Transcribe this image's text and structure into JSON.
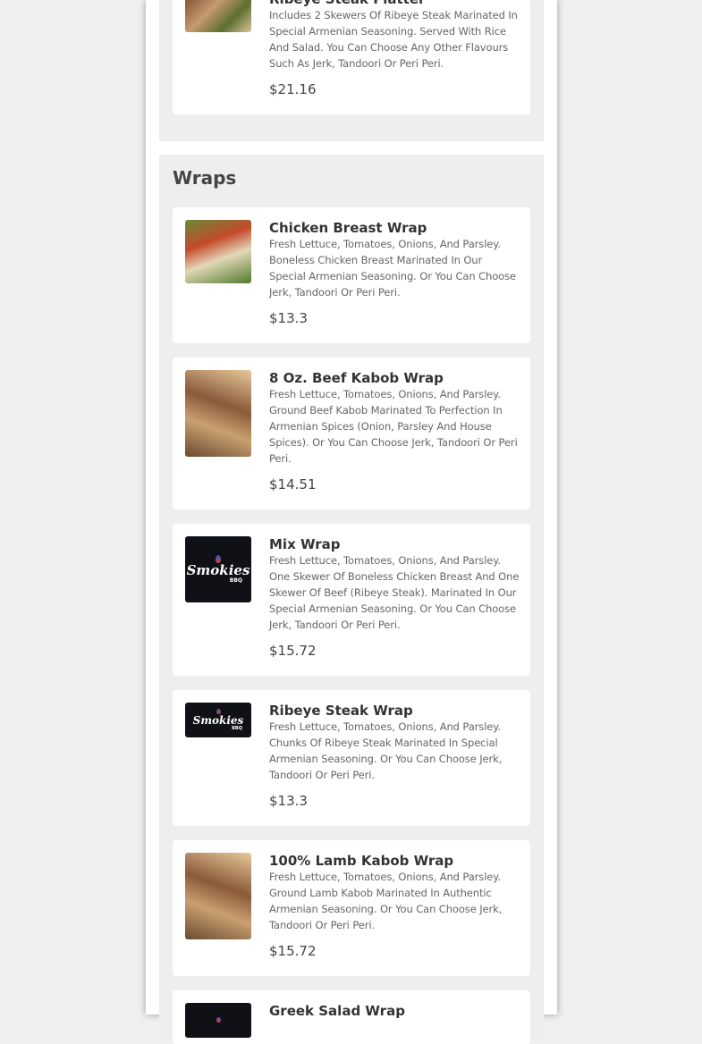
{
  "prev_section": {
    "item": {
      "name": "Ribeye Steak Platter",
      "description": "Includes 2 Skewers Of Ribeye Steak Marinated In Special Armenian Seasoning. Served With Rice And Salad. You Can Choose Any Other Flavours Such As Jerk, Tandoori Or Peri Peri.",
      "price": "$21.16"
    }
  },
  "wraps": {
    "title": "Wraps",
    "items": [
      {
        "name": "Chicken Breast Wrap",
        "description": "Fresh Lettuce, Tomatoes, Onions, And Parsley. Boneless Chicken Breast Marinated In Our Special Armenian Seasoning. Or You Can Choose Jerk, Tandoori Or Peri Peri.",
        "price": "$13.3"
      },
      {
        "name": "8 Oz. Beef Kabob Wrap",
        "description": "Fresh Lettuce, Tomatoes, Onions, And Parsley. Ground Beef Kabob Marinated To Perfection In Armenian Spices (Onion, Parsley And House Spices). Or You Can Choose Jerk, Tandoori Or Peri Peri.",
        "price": "$14.51"
      },
      {
        "name": "Mix Wrap",
        "description": "Fresh Lettuce, Tomatoes, Onions, And Parsley. One Skewer Of Boneless Chicken Breast And One Skewer Of Beef (Ribeye Steak). Marinated In Our Special Armenian Seasoning. Or You Can Choose Jerk, Tandoori Or Peri Peri.",
        "price": "$15.72"
      },
      {
        "name": "Ribeye Steak Wrap",
        "description": "Fresh Lettuce, Tomatoes, Onions, And Parsley. Chunks Of Ribeye Steak Marinated In Special Armenian Seasoning. Or You Can Choose Jerk, Tandoori Or Peri Peri.",
        "price": "$13.3"
      },
      {
        "name": "100% Lamb Kabob Wrap",
        "description": "Fresh Lettuce, Tomatoes, Onions, And Parsley. Ground Lamb Kabob Marinated In Authentic Armenian Seasoning. Or You Can Choose Jerk, Tandoori Or Peri Peri.",
        "price": "$15.72"
      },
      {
        "name": "Greek Salad Wrap"
      }
    ]
  },
  "logo": {
    "text": "Smokies",
    "sub": "BBQ"
  },
  "colors": {
    "page_bg": "#f0f0f0",
    "section_bg": "#eeeeee",
    "card_bg": "#ffffff",
    "logo_bg": "#0f1116"
  }
}
